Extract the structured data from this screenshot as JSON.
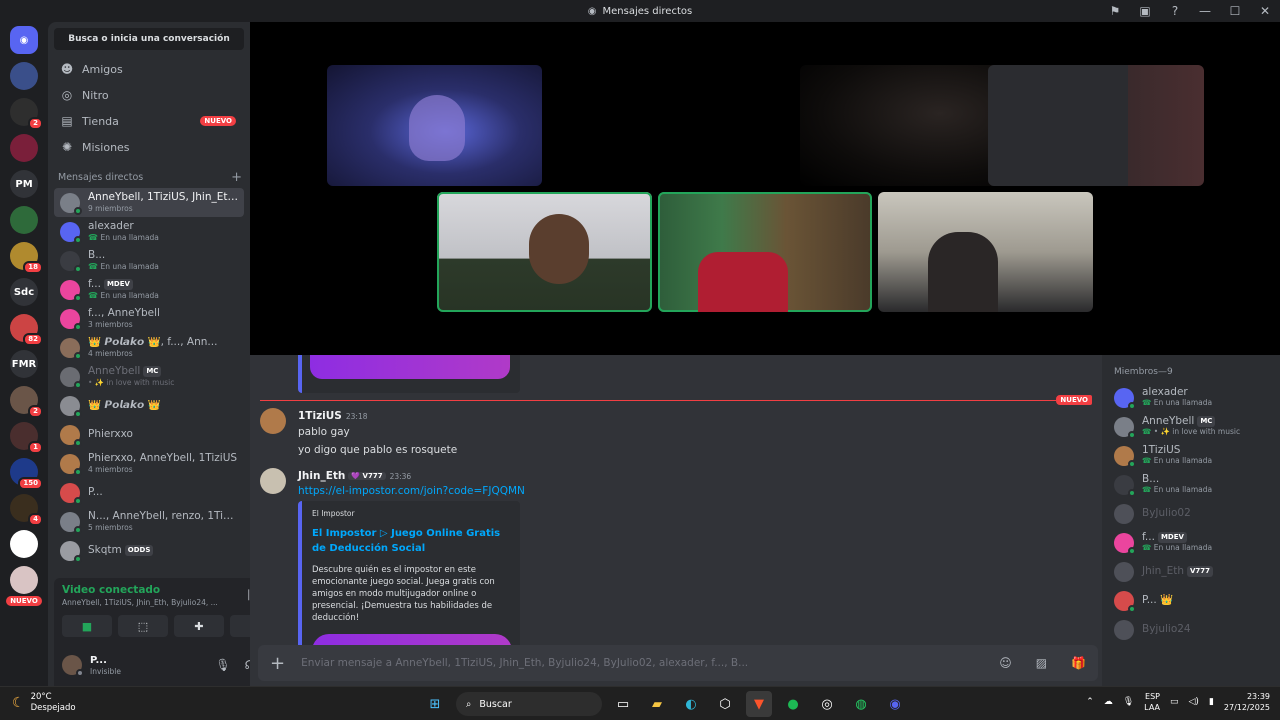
{
  "titlebar": {
    "title": "Mensajes directos"
  },
  "rail": {
    "servers": [
      {
        "label": "",
        "badge": ""
      },
      {
        "label": "",
        "badge": "2"
      },
      {
        "label": "",
        "badge": ""
      },
      {
        "label": "PM",
        "badge": ""
      },
      {
        "label": "",
        "badge": ""
      },
      {
        "label": "",
        "badge": "18"
      },
      {
        "label": "Sdc",
        "badge": ""
      },
      {
        "label": "",
        "badge": "82"
      },
      {
        "label": "FMR",
        "badge": ""
      },
      {
        "label": "",
        "badge": "2"
      },
      {
        "label": "",
        "badge": "1"
      },
      {
        "label": "",
        "badge": "150"
      },
      {
        "label": "",
        "badge": "4"
      },
      {
        "label": "",
        "badge": ""
      },
      {
        "label": "",
        "badge": ""
      }
    ],
    "nuevo": "NUEVO"
  },
  "sidebar": {
    "search": "Busca o inicia una conversación",
    "nav": [
      {
        "label": "Amigos",
        "icon": "friends-icon",
        "glyph": "☻"
      },
      {
        "label": "Nitro",
        "icon": "nitro-icon",
        "glyph": "◎"
      },
      {
        "label": "Tienda",
        "icon": "shop-icon",
        "glyph": "▤",
        "badge": "NUEVO"
      },
      {
        "label": "Misiones",
        "icon": "quests-icon",
        "glyph": "✺"
      }
    ],
    "dm_header": "Mensajes directos",
    "dms": [
      {
        "name": "AnneYbell, 1TiziUS, Jhin_Eth, ...",
        "sub": "9 miembros",
        "color": "#7a7f88",
        "active": true
      },
      {
        "name": "alexader",
        "sub": "En una llamada",
        "color": "#5865f2",
        "call": true
      },
      {
        "name": "B...",
        "sub": "En una llamada",
        "color": "#3a3c42",
        "call": true
      },
      {
        "name": "f...",
        "tag": "MDEV",
        "sub": "En una llamada",
        "color": "#eb459e",
        "call": true
      },
      {
        "name": "f..., AnneYbell",
        "sub": "3 miembros",
        "color": "#eb459e"
      },
      {
        "name": "👑 𝙋𝙤𝙡𝙖𝙠𝙤 👑, f..., Ann...",
        "sub": "4 miembros",
        "color": "#8a6d5a"
      },
      {
        "name": "AnneYbell",
        "tag": "MC",
        "sub": "• ✨ in love with music",
        "color": "#6a6c72",
        "faded": true
      },
      {
        "name": "👑 𝙋𝙤𝙡𝙖𝙠𝙤 👑",
        "sub": "",
        "color": "#8a8c92"
      },
      {
        "name": "Phierxxo",
        "sub": "",
        "color": "#b07a4a"
      },
      {
        "name": "Phierxxo, AnneYbell, 1TiziUS",
        "sub": "4 miembros",
        "color": "#b07a4a"
      },
      {
        "name": "P...",
        "sub": "",
        "color": "#d64b4b"
      },
      {
        "name": "N..., AnneYbell, renzo, 1TiziUS",
        "sub": "5 miembros",
        "color": "#7a7f88"
      },
      {
        "name": "Skqtm",
        "tag": "ODDS",
        "sub": "",
        "color": "#9a9ca2"
      }
    ],
    "voice": {
      "status": "Video conectado",
      "participants": "AnneYbell, 1TiziUS, Jhin_Eth, Byjulio24, ..."
    },
    "user": {
      "name": "P...",
      "status": "Invisible"
    }
  },
  "chat": {
    "new_label": "NUEVO",
    "messages": [
      {
        "author": "1TiziUS",
        "time": "23:18",
        "lines": [
          "pablo gay",
          "yo digo que pablo es rosquete"
        ]
      },
      {
        "author": "Jhin_Eth",
        "tag": "V777",
        "time": "23:36",
        "link": "https://el-impostor.com/join?code=FJQQMN",
        "embed": {
          "provider": "El Impostor",
          "title": "El Impostor ▷ Juego Online Gratis de Deducción Social",
          "description": "Descubre quién es el impostor en este emocionante juego social. Juega gratis con amigos en modo multijugador online o presencial. ¡Demuestra tus habilidades de deducción!"
        }
      }
    ],
    "composer_placeholder": "Enviar mensaje a AnneYbell, 1TiziUS, Jhin_Eth, Byjulio24, ByJulio02, alexader, f..., B..."
  },
  "members": {
    "header": "Miembros—9",
    "list": [
      {
        "name": "alexader",
        "sub": "En una llamada",
        "color": "#5865f2"
      },
      {
        "name": "AnneYbell",
        "tag": "MC",
        "sub": "• ✨ in love with music",
        "color": "#7a7f88"
      },
      {
        "name": "1TiziUS",
        "sub": "En una llamada",
        "color": "#b07a4a"
      },
      {
        "name": "B...",
        "sub": "En una llamada",
        "color": "#3a3c42"
      },
      {
        "name": "ByJulio02",
        "sub": "",
        "color": "#4e5058",
        "faded": true
      },
      {
        "name": "f...",
        "tag": "MDEV",
        "sub": "En una llamada",
        "color": "#eb459e"
      },
      {
        "name": "Jhin_Eth",
        "tag": "V777",
        "sub": "",
        "color": "#4e5058",
        "faded": true
      },
      {
        "name": "P... 👑",
        "sub": "",
        "color": "#d64b4b"
      },
      {
        "name": "Byjulio24",
        "sub": "",
        "color": "#4e5058",
        "faded": true
      }
    ]
  },
  "taskbar": {
    "weather_temp": "20°C",
    "weather_desc": "Despejado",
    "search": "Buscar",
    "lang": "ESP",
    "lang2": "LAA",
    "time": "23:39",
    "date": "27/12/2025"
  }
}
